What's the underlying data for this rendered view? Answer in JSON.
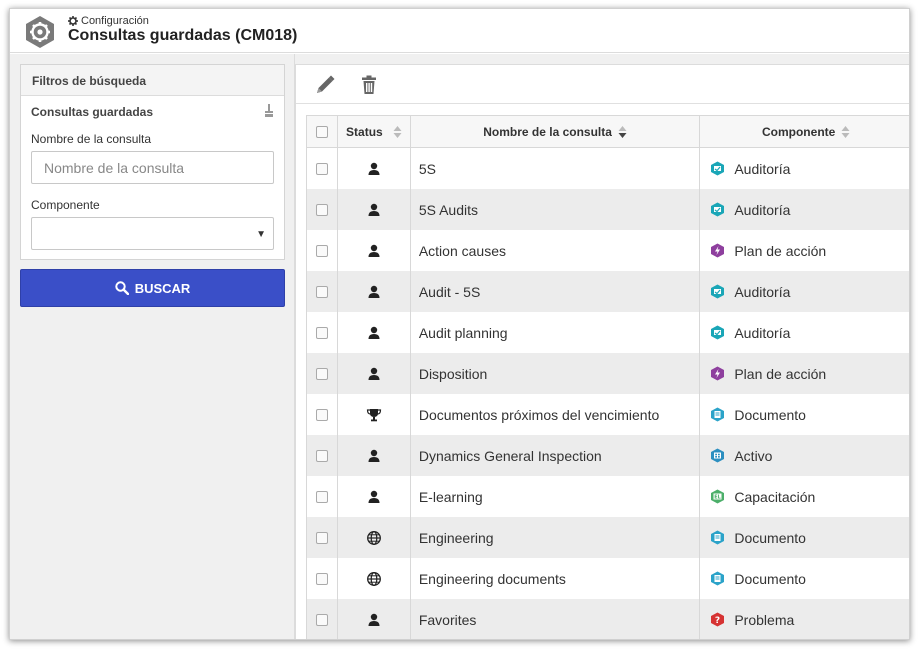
{
  "header": {
    "breadcrumb": "Configuración",
    "title": "Consultas guardadas (CM018)"
  },
  "filters": {
    "panel_title": "Filtros de búsqueda",
    "section_title": "Consultas guardadas",
    "name_label": "Nombre de la consulta",
    "name_placeholder": "Nombre de la consulta",
    "name_value": "",
    "component_label": "Componente",
    "component_value": "",
    "search_button": "BUSCAR"
  },
  "grid": {
    "columns": {
      "status": "Status",
      "name": "Nombre de la consulta",
      "component": "Componente"
    },
    "rows": [
      {
        "status_icon": "user-icon",
        "name": "5S",
        "component": "Auditoría",
        "component_icon": "audit-icon"
      },
      {
        "status_icon": "user-icon",
        "name": "5S Audits",
        "component": "Auditoría",
        "component_icon": "audit-icon"
      },
      {
        "status_icon": "user-icon",
        "name": "Action causes",
        "component": "Plan de acción",
        "component_icon": "action-plan-icon"
      },
      {
        "status_icon": "user-icon",
        "name": "Audit - 5S",
        "component": "Auditoría",
        "component_icon": "audit-icon"
      },
      {
        "status_icon": "user-icon",
        "name": "Audit planning",
        "component": "Auditoría",
        "component_icon": "audit-icon"
      },
      {
        "status_icon": "user-icon",
        "name": "Disposition",
        "component": "Plan de acción",
        "component_icon": "action-plan-icon"
      },
      {
        "status_icon": "trophy-icon",
        "name": "Documentos próximos del vencimiento",
        "component": "Documento",
        "component_icon": "document-icon"
      },
      {
        "status_icon": "user-icon",
        "name": "Dynamics General Inspection",
        "component": "Activo",
        "component_icon": "asset-icon"
      },
      {
        "status_icon": "user-icon",
        "name": "E-learning",
        "component": "Capacitación",
        "component_icon": "training-icon"
      },
      {
        "status_icon": "globe-icon",
        "name": "Engineering",
        "component": "Documento",
        "component_icon": "document-icon"
      },
      {
        "status_icon": "globe-icon",
        "name": "Engineering documents",
        "component": "Documento",
        "component_icon": "document-icon"
      },
      {
        "status_icon": "user-icon",
        "name": "Favorites",
        "component": "Problema",
        "component_icon": "problem-icon"
      }
    ]
  },
  "colors": {
    "search_button": "#3a4fc8",
    "audit": "#1aa6b7",
    "action_plan": "#8e3f9e",
    "document": "#2ba3c9",
    "asset": "#2c8fc0",
    "training": "#4caf6a",
    "problem": "#d63333"
  }
}
